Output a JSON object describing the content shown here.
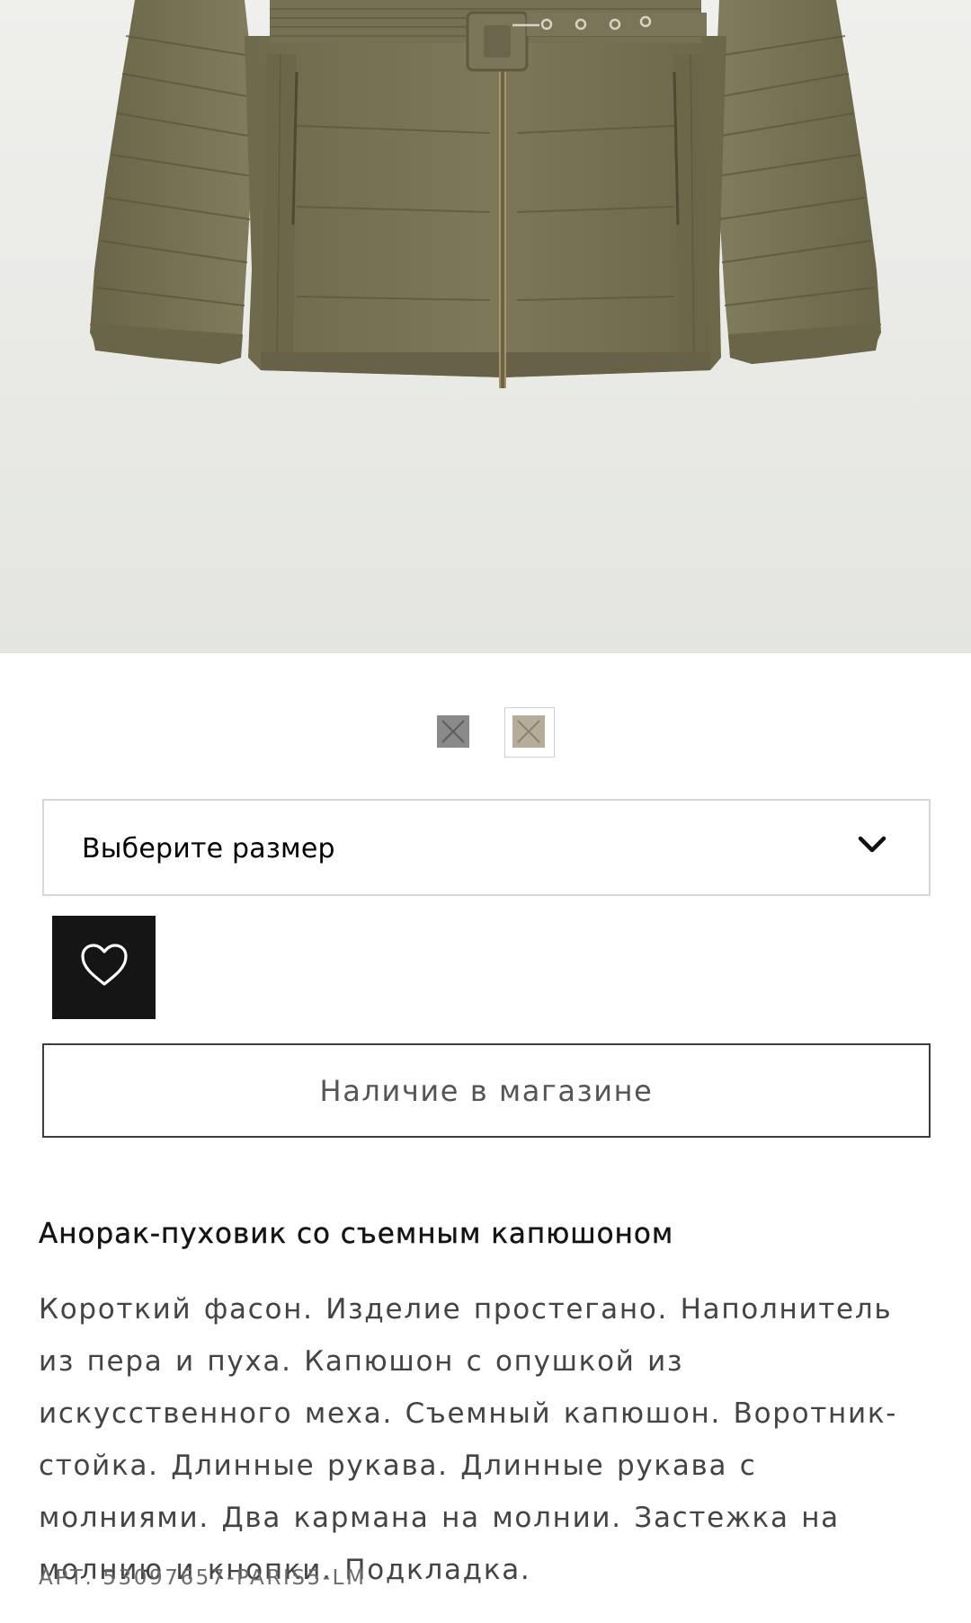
{
  "product": {
    "image_alt": "khaki quilted down anorak with belt",
    "image_colors": {
      "background": "#ebebe8",
      "jacket": "#7b7656",
      "jacket_shadow": "#5f5b41",
      "jacket_highlight": "#8e8a6a"
    },
    "swatches": [
      {
        "name": "grey",
        "color": "#8a8a8a",
        "selected": false
      },
      {
        "name": "khaki",
        "color": "#b5ad9a",
        "selected": true
      }
    ],
    "size_select": {
      "label": "Выберите размер",
      "icon": "chevron-down-icon"
    },
    "favorite": {
      "icon": "heart-icon"
    },
    "store_availability_label": "Наличие в магазине",
    "title": "Анорак-пуховик со съемным капюшоном",
    "description": "Короткий фасон. Изделие простегано. Наполнитель из пера и пуха. Капюшон с опушкой из искусственного меха. Съемный капюшон. Воротник-стойка. Длинные рукава. Длинные рукава с молниями. Два кармана на молнии. Застежка на молнию и кнопки. Подкладка.",
    "sku": "АРТ. 53097657-PARIS5-LM"
  }
}
